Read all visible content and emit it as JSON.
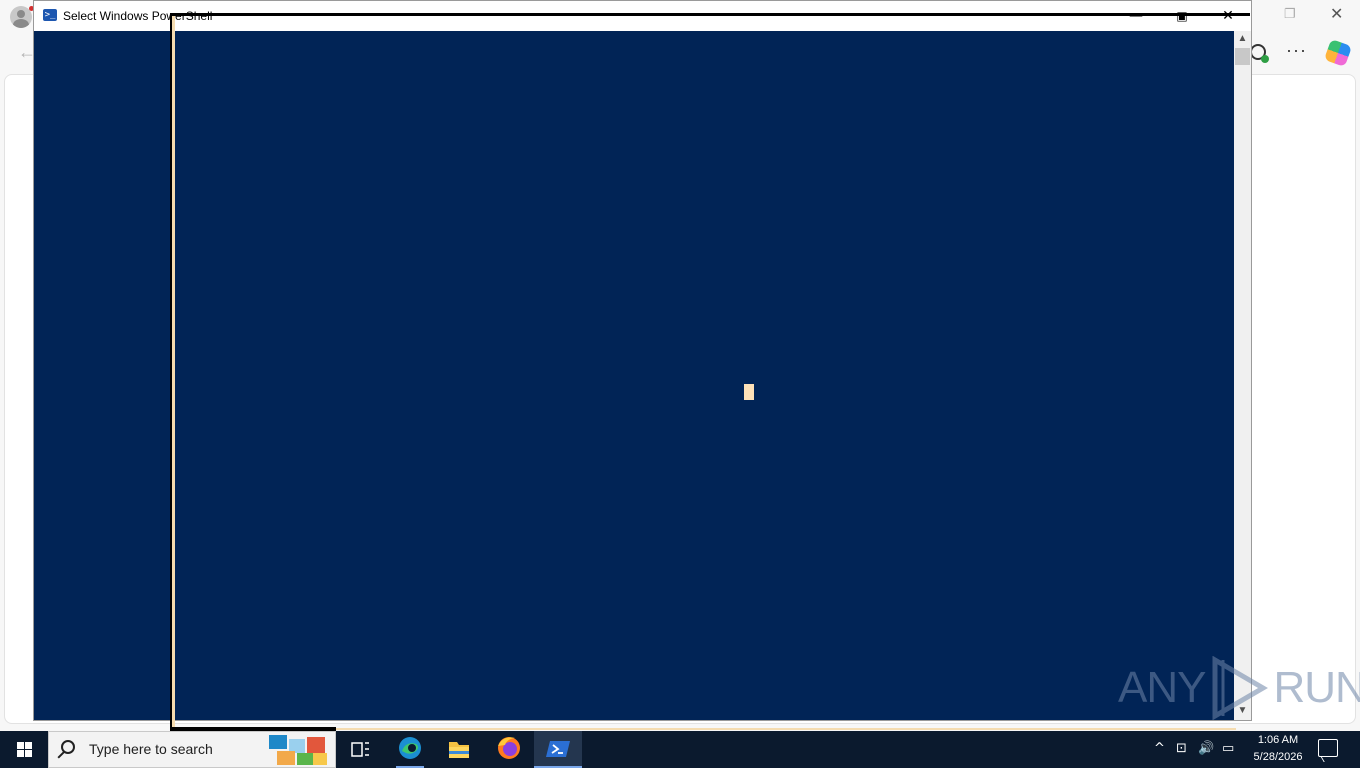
{
  "window": {
    "title": "Select Windows PowerShell",
    "controls": {
      "minimize": "—",
      "maximize": "▣",
      "close": "✕"
    },
    "console_background": "#012456",
    "cursor_color": "#fde1b8"
  },
  "background_app": {
    "name": "Microsoft Edge",
    "toolbar_icons": [
      "profile-icon",
      "back-icon",
      "extension-icon",
      "more-icon",
      "copilot-icon"
    ],
    "more_label": "···"
  },
  "watermark": {
    "text_left": "ANY",
    "text_right": "RUN"
  },
  "taskbar": {
    "search_placeholder": "Type here to search",
    "apps": [
      "task-view",
      "microsoft-edge",
      "file-explorer",
      "firefox",
      "windows-powershell"
    ],
    "active_app": "windows-powershell",
    "tray": {
      "show_hidden": "^",
      "time": "1:06 AM",
      "date": "5/28/2026"
    }
  }
}
